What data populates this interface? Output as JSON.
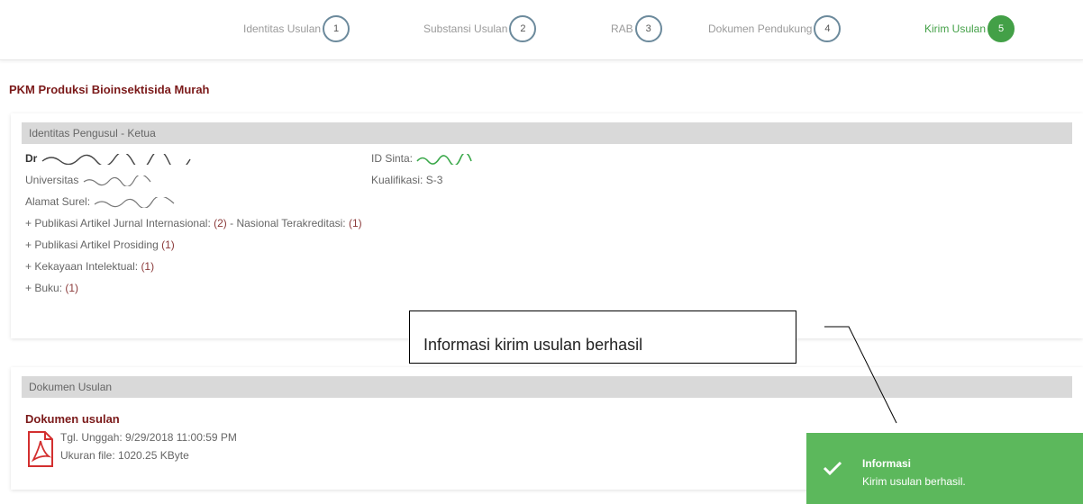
{
  "steps": [
    {
      "label": "Identitas Usulan",
      "num": "1"
    },
    {
      "label": "Substansi Usulan",
      "num": "2"
    },
    {
      "label": "RAB",
      "num": "3"
    },
    {
      "label": "Dokumen Pendukung",
      "num": "4"
    },
    {
      "label": "Kirim Usulan",
      "num": "5"
    }
  ],
  "proposal_title": "PKM Produksi Bioinsektisida Murah",
  "identity": {
    "header": "Identitas Pengusul - Ketua",
    "name_prefix": "Dr",
    "sinta_label": "ID Sinta:",
    "university_prefix": "Universitas",
    "kualifikasi": "Kualifikasi: S-3",
    "email_label": "Alamat Surel:",
    "pub_intl_label": "+ Publikasi Artikel Jurnal Internasional:",
    "pub_intl_count": "(2)",
    "pub_nat_label": "- Nasional Terakreditasi:",
    "pub_nat_count": "(1)",
    "prosiding_label": "+ Publikasi Artikel Prosiding",
    "prosiding_count": "(1)",
    "ki_label": "+ Kekayaan Intelektual:",
    "ki_count": "(1)",
    "buku_label": "+ Buku:",
    "buku_count": "(1)"
  },
  "documents": {
    "header": "Dokumen Usulan",
    "title": "Dokumen usulan",
    "upload_date": "Tgl. Unggah: 9/29/2018 11:00:59 PM",
    "file_size": "Ukuran file: 1020.25 KByte"
  },
  "callout_text": "Informasi kirim usulan berhasil",
  "toast": {
    "title": "Informasi",
    "message": "Kirim usulan berhasil."
  },
  "colors": {
    "active_step": "#43a047",
    "title_red": "#7b1a1a",
    "toast_bg": "#5cb85c",
    "sinta_green": "#3aa84a"
  },
  "icons": [
    "pdf-icon",
    "check-icon"
  ]
}
